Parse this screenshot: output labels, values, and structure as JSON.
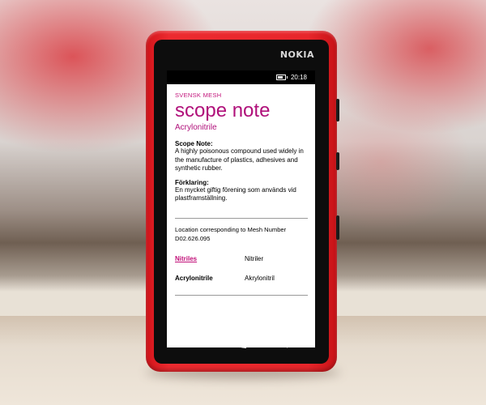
{
  "device": {
    "brand": "NOKIA"
  },
  "status_bar": {
    "time": "20:18"
  },
  "app": {
    "name": "SVENSK MESH",
    "page_title": "scope note",
    "subtitle": "Acrylonitrile"
  },
  "sections": [
    {
      "label": "Scope Note:",
      "text": "A highly poisonous compound used widely in the manufacture of plastics, adhesives and synthetic rubber."
    },
    {
      "label": "Förklaring:",
      "text": "En mycket giftig förening som används vid plastframställning."
    }
  ],
  "location": {
    "text": "Location corresponding to Mesh Number",
    "number": "D02.626.095"
  },
  "related": [
    {
      "term": "Nitriles",
      "translation": "Nitriler"
    },
    {
      "term": "Acrylonitrile",
      "translation": "Akrylonitril"
    }
  ],
  "nav": {
    "back_icon": "back-arrow",
    "start_icon": "windows-logo",
    "search_icon": "magnifier"
  },
  "colors": {
    "accent": "#c2127a",
    "phone_body": "#e8262b"
  }
}
